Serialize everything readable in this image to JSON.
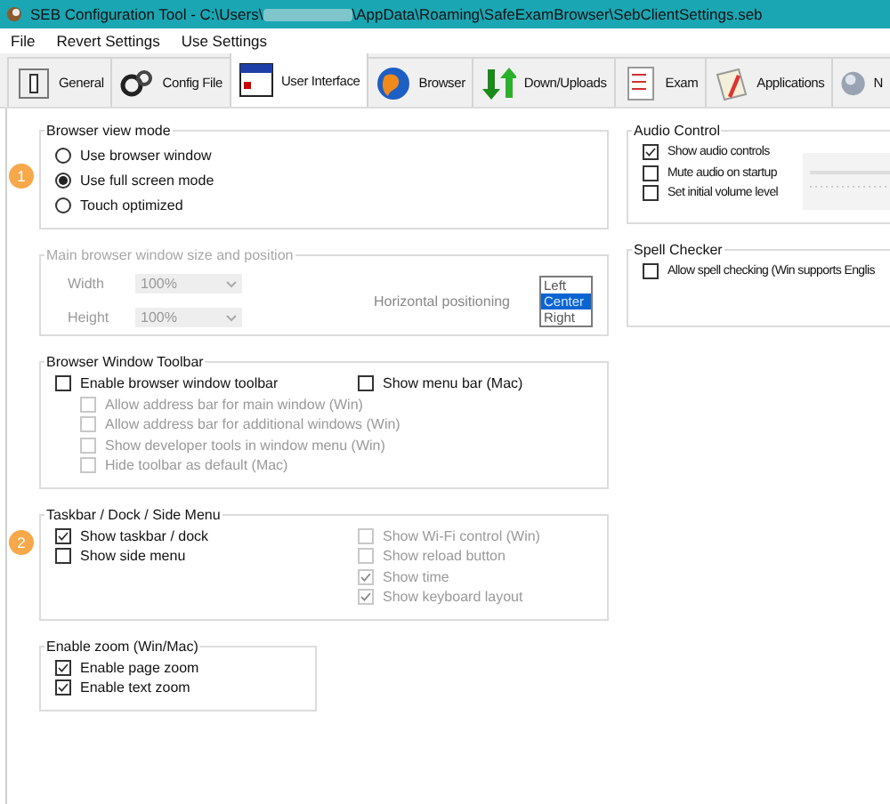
{
  "window": {
    "title_prefix": "SEB Configuration Tool - C:\\Users\\",
    "title_suffix": "\\AppData\\Roaming\\SafeExamBrowser\\SebClientSettings.seb"
  },
  "menu": [
    "File",
    "Revert Settings",
    "Use Settings"
  ],
  "tabs": [
    {
      "label": "General",
      "kind": "switch",
      "selected": false
    },
    {
      "label": "Config File",
      "kind": "gears",
      "selected": false
    },
    {
      "label": "User Interface",
      "kind": "window",
      "selected": true
    },
    {
      "label": "Browser",
      "kind": "globe",
      "selected": false
    },
    {
      "label": "Down/Uploads",
      "kind": "arrows",
      "selected": false
    },
    {
      "label": "Exam",
      "kind": "document",
      "selected": false
    },
    {
      "label": "Applications",
      "kind": "apps",
      "selected": false
    },
    {
      "label": "N",
      "kind": "sphere",
      "selected": false
    }
  ],
  "browser_view_mode": {
    "title": "Browser view mode",
    "badge": "1",
    "options": [
      {
        "label": "Use browser window",
        "selected": false
      },
      {
        "label": "Use full screen mode",
        "selected": true
      },
      {
        "label": "Touch optimized",
        "selected": false
      }
    ]
  },
  "main_window": {
    "title": "Main browser window size and position",
    "disabled": true,
    "width": {
      "label": "Width",
      "value": "100%"
    },
    "height": {
      "label": "Height",
      "value": "100%"
    },
    "positioning": {
      "label": "Horizontal positioning",
      "options": [
        {
          "label": "Left",
          "selected": false
        },
        {
          "label": "Center",
          "selected": true
        },
        {
          "label": "Right",
          "selected": false
        }
      ]
    }
  },
  "audio": {
    "title": "Audio Control",
    "options": [
      {
        "label": "Show audio controls",
        "checked": true
      },
      {
        "label": "Mute audio on startup",
        "checked": false
      },
      {
        "label": "Set initial volume level",
        "checked": false
      }
    ]
  },
  "spell": {
    "title": "Spell Checker",
    "options": [
      {
        "label": "Allow spell checking (Win supports Englis",
        "checked": false
      }
    ]
  },
  "toolbar": {
    "title": "Browser Window Toolbar",
    "left": [
      {
        "label": "Enable browser window toolbar",
        "checked": false,
        "disabled": false,
        "children": [
          {
            "label": "Allow address bar for main window (Win)",
            "checked": false,
            "disabled": true
          },
          {
            "label": "Allow address bar for additional windows (Win)",
            "checked": false,
            "disabled": true
          },
          {
            "label": "Show developer tools in window menu (Win)",
            "checked": false,
            "disabled": true
          },
          {
            "label": "Hide toolbar as default (Mac)",
            "checked": false,
            "disabled": true
          }
        ]
      }
    ],
    "right": [
      {
        "label": "Show menu bar (Mac)",
        "checked": false,
        "disabled": false
      }
    ]
  },
  "taskbar": {
    "title": "Taskbar / Dock / Side Menu",
    "badge": "2",
    "left": [
      {
        "label": "Show taskbar / dock",
        "checked": true,
        "disabled": false
      },
      {
        "label": "Show side menu",
        "checked": false,
        "disabled": false
      }
    ],
    "right": [
      {
        "label": "Show Wi-Fi control (Win)",
        "checked": false,
        "disabled": true
      },
      {
        "label": "Show reload button",
        "checked": false,
        "disabled": true
      },
      {
        "label": "Show time",
        "checked": true,
        "disabled": true
      },
      {
        "label": "Show keyboard layout",
        "checked": true,
        "disabled": true
      }
    ]
  },
  "zoom": {
    "title": "Enable zoom (Win/Mac)",
    "options": [
      {
        "label": "Enable page zoom",
        "checked": true
      },
      {
        "label": "Enable text zoom",
        "checked": true
      }
    ]
  }
}
